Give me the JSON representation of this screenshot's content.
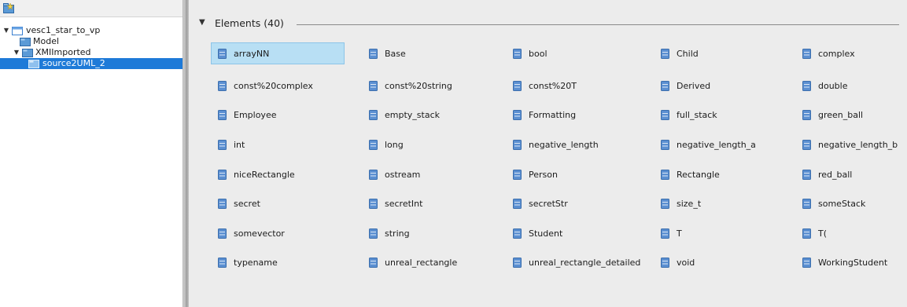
{
  "tree": {
    "nodes": [
      {
        "label": "vesc1_star_to_vp",
        "icon": "project-icon",
        "expanded": true
      },
      {
        "label": "Model",
        "icon": "package-icon"
      },
      {
        "label": "XMIImported",
        "icon": "package-icon",
        "expanded": true
      },
      {
        "label": "source2UML_2",
        "icon": "package-icon",
        "selected": true
      }
    ]
  },
  "elements_panel": {
    "title": "Elements (40)",
    "collapse_icon": "triangle-down-icon",
    "items": [
      "arrayNN",
      "Base",
      "bool",
      "Child",
      "complex",
      "const%20complex",
      "const%20string",
      "const%20T",
      "Derived",
      "double",
      "Employee",
      "empty_stack",
      "Formatting",
      "full_stack",
      "green_ball",
      "int",
      "long",
      "negative_length",
      "negative_length_a",
      "negative_length_b",
      "niceRectangle",
      "ostream",
      "Person",
      "Rectangle",
      "red_ball",
      "secret",
      "secretInt",
      "secretStr",
      "size_t",
      "someStack",
      "somevector",
      "string",
      "Student",
      "T",
      "T(",
      "typename",
      "unreal_rectangle",
      "unreal_rectangle_detailed",
      "void",
      "WorkingStudent"
    ],
    "selected_item": "arrayNN",
    "item_icon": "class-icon"
  },
  "colors": {
    "selection_blue": "#1e7ad8",
    "item_selected_bg": "#b8dff4",
    "panel_bg": "#ececec",
    "class_icon": "#5b8fd1"
  }
}
